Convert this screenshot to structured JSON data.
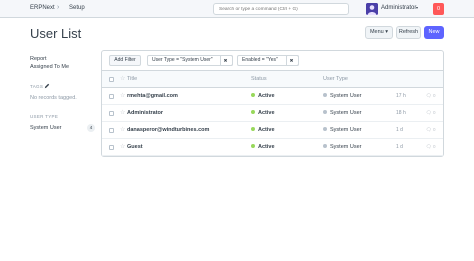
{
  "navbar": {
    "brand": "ERPNext",
    "breadcrumb_sep": "›",
    "breadcrumb": "Setup",
    "search_placeholder": "Search or type a command (Ctrl + G)",
    "user_name": "Administrator",
    "user_caret": "▾",
    "notification_count": "0"
  },
  "page": {
    "title": "User List",
    "menu_label": "Menu ▾",
    "refresh_label": "Refresh",
    "new_label": "New"
  },
  "sidebar": {
    "report": "Report",
    "assigned_to_me": "Assigned To Me",
    "tags_heading": "TAGS",
    "tags_empty": "No records tagged.",
    "user_type_heading": "USER TYPE",
    "user_type_item": "System User",
    "user_type_count": "4"
  },
  "filters": {
    "add_filter": "Add Filter",
    "chips": [
      {
        "label": "User Type = \"System User\"",
        "remove": "✖"
      },
      {
        "label": "Enabled = \"Yes\"",
        "remove": "✖"
      }
    ]
  },
  "table": {
    "columns": {
      "title": "Title",
      "status": "Status",
      "user_type": "User Type"
    },
    "rows": [
      {
        "title": "rmehta@gmail.com",
        "status": "Active",
        "user_type": "System User",
        "modified": "17 h",
        "comments": "0"
      },
      {
        "title": "Administrator",
        "status": "Active",
        "user_type": "System User",
        "modified": "18 h",
        "comments": "0"
      },
      {
        "title": "danasperor@windturbines.com",
        "status": "Active",
        "user_type": "System User",
        "modified": "1 d",
        "comments": "0"
      },
      {
        "title": "Guest",
        "status": "Active",
        "user_type": "System User",
        "modified": "1 d",
        "comments": "0"
      }
    ]
  },
  "colors": {
    "active_dot": "#98d85b",
    "user_type_dot": "#b8c2cc",
    "primary": "#5e64ff",
    "danger": "#ff5858"
  },
  "icons": {
    "breadcrumb": "chevron-right-icon",
    "avatar": "user-avatar",
    "tag_edit": "pencil-icon",
    "star": "star-icon",
    "comment": "comment-icon"
  }
}
